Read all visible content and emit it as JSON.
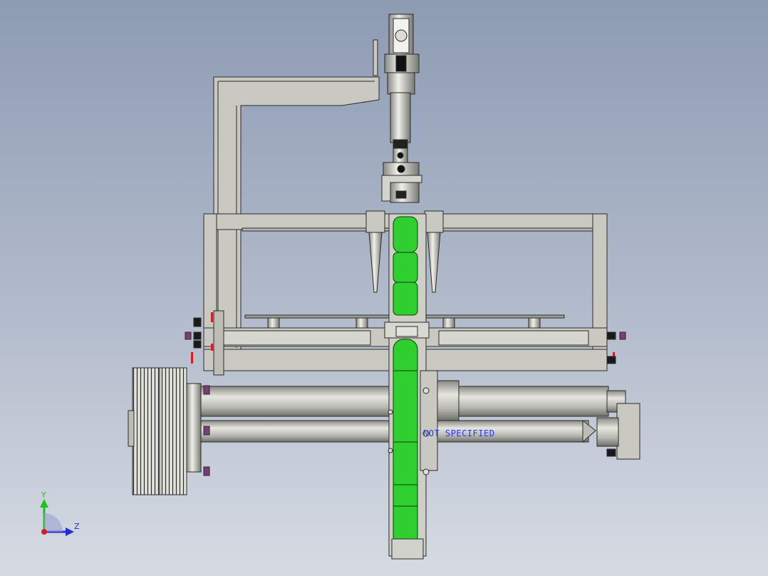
{
  "viewport": {
    "note_text": "NOT SPECIFIED",
    "axis_y_label": "Y",
    "axis_z_label": "Z"
  },
  "colors": {
    "background_top": "#8d9bb3",
    "background_bottom": "#d6dbe3",
    "part_gray": "#c9c9c2",
    "part_edge": "#2a2a2a",
    "chain_green": "#2fcf2f",
    "note_blue": "#1f3cff",
    "fastener_purple": "#7a3c7a",
    "fastener_red": "#d42020"
  }
}
